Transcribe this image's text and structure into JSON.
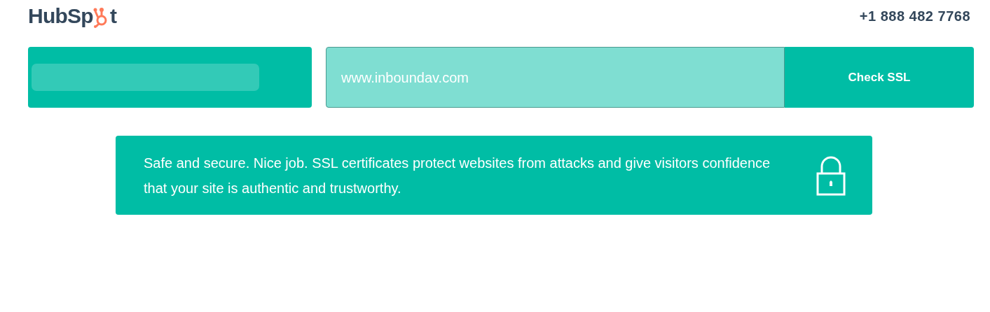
{
  "header": {
    "logo_parts": [
      "HubSp",
      "t"
    ],
    "phone": "+1 888 482 7768"
  },
  "checker": {
    "url_value": "www.inboundav.com",
    "button": "Check SSL"
  },
  "result": {
    "kind": "secure",
    "message": "Safe and secure. Nice job. SSL certificates protect websites from attacks and give visitors confidence that your site is authentic and trustworthy."
  }
}
